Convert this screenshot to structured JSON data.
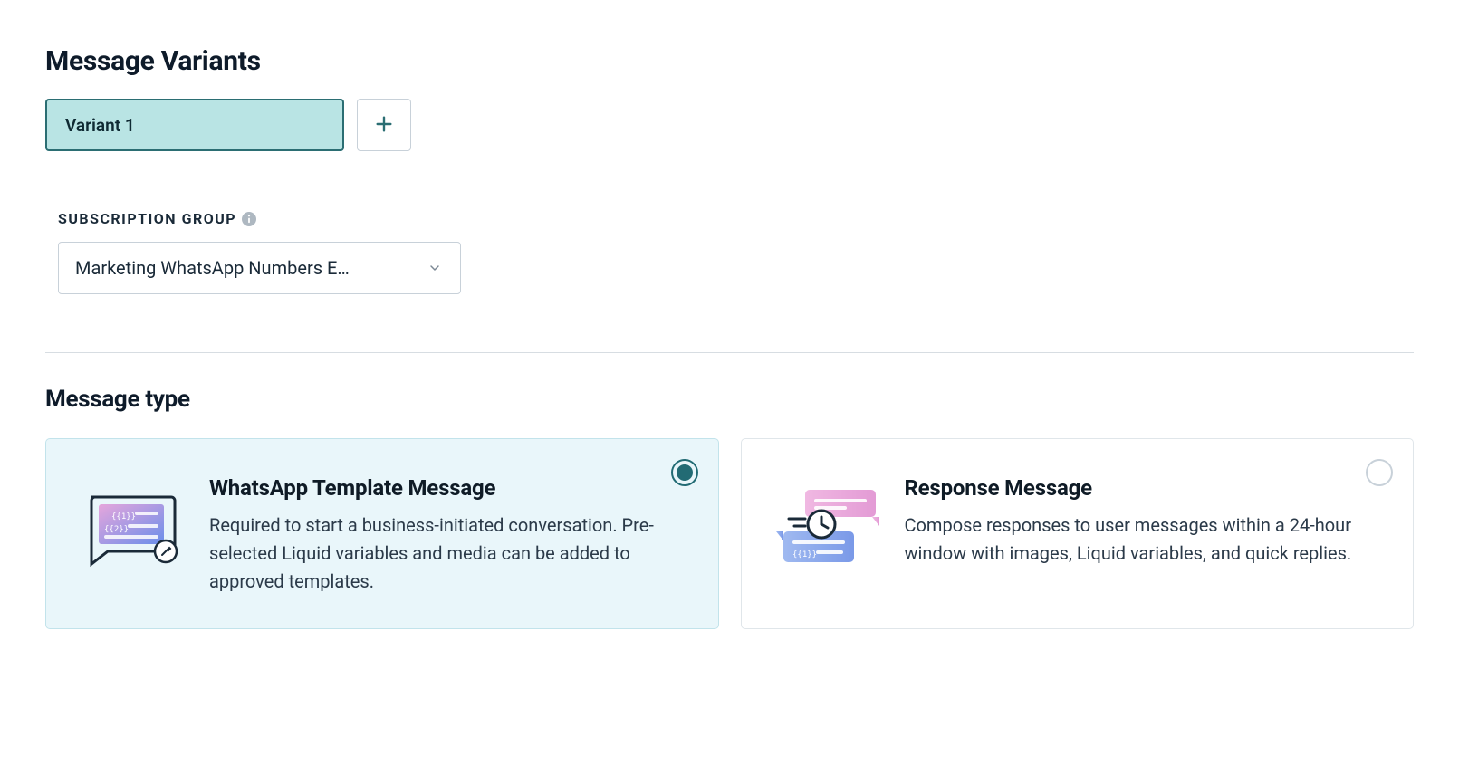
{
  "variants": {
    "heading": "Message Variants",
    "active_label": "Variant 1"
  },
  "subscription": {
    "label": "SUBSCRIPTION GROUP",
    "selected": "Marketing WhatsApp Numbers E…"
  },
  "message_type": {
    "heading": "Message type",
    "options": [
      {
        "title": "WhatsApp Template Message",
        "desc": "Required to start a business-initiated conversation. Pre-selected Liquid variables and media can be added to approved templates.",
        "selected": true
      },
      {
        "title": "Response Message",
        "desc": "Compose responses to user messages within a 24-hour window with images, Liquid variables, and quick replies.",
        "selected": false
      }
    ]
  }
}
